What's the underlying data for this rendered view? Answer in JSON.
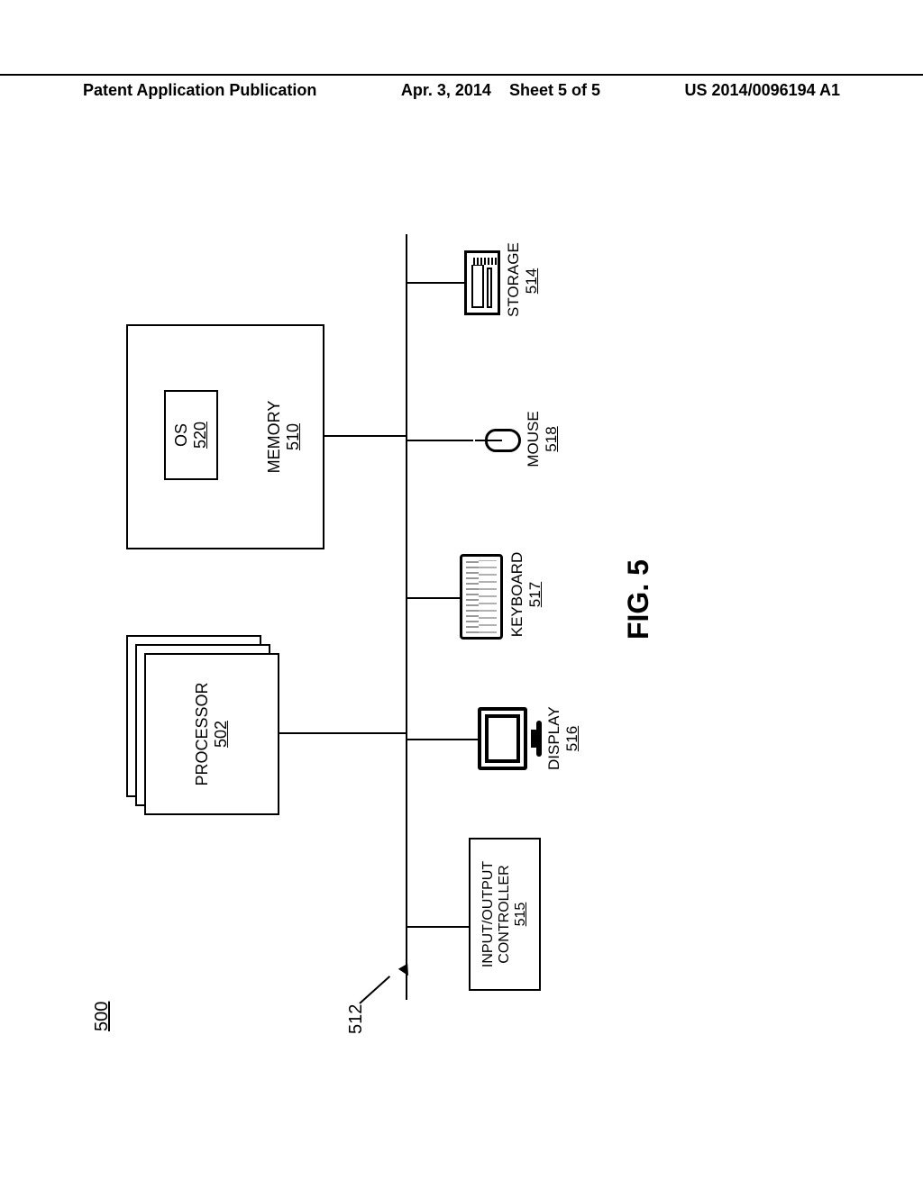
{
  "header": {
    "left": "Patent Application Publication",
    "mid_date": "Apr. 3, 2014",
    "mid_sheet": "Sheet 5 of 5",
    "right": "US 2014/0096194 A1"
  },
  "refs": {
    "system": "500",
    "bus": "512"
  },
  "processor": {
    "name": "PROCESSOR",
    "num": "502"
  },
  "memory": {
    "name": "MEMORY",
    "num": "510"
  },
  "os": {
    "name": "OS",
    "num": "520"
  },
  "io": {
    "name1": "INPUT/OUTPUT",
    "name2": "CONTROLLER",
    "num": "515"
  },
  "display": {
    "name": "DISPLAY",
    "num": "516"
  },
  "keyboard": {
    "name": "KEYBOARD",
    "num": "517"
  },
  "mouse": {
    "name": "MOUSE",
    "num": "518"
  },
  "storage": {
    "name": "STORAGE",
    "num": "514"
  },
  "figure": "FIG. 5"
}
